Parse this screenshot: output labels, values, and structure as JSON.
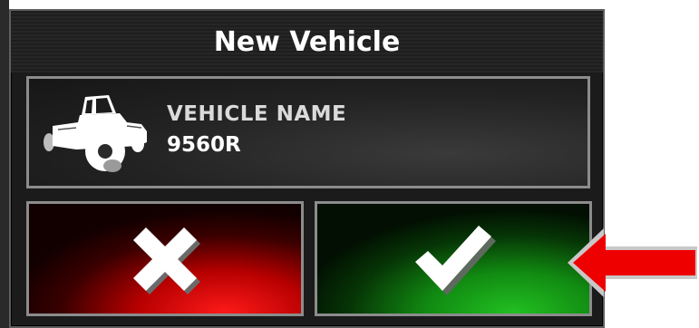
{
  "dialog": {
    "title": "New Vehicle",
    "vehicle": {
      "label": "VEHICLE NAME",
      "value": "9560R",
      "icon": "tractor-icon"
    },
    "buttons": {
      "cancel_icon": "cancel-x-icon",
      "confirm_icon": "checkmark-icon"
    }
  },
  "annotation": {
    "arrow_icon": "red-arrow-icon",
    "arrow_color": "#ee0000"
  },
  "colors": {
    "cancel": "#e00000",
    "confirm": "#1aa01a",
    "panel_border": "#8c8c8c"
  }
}
